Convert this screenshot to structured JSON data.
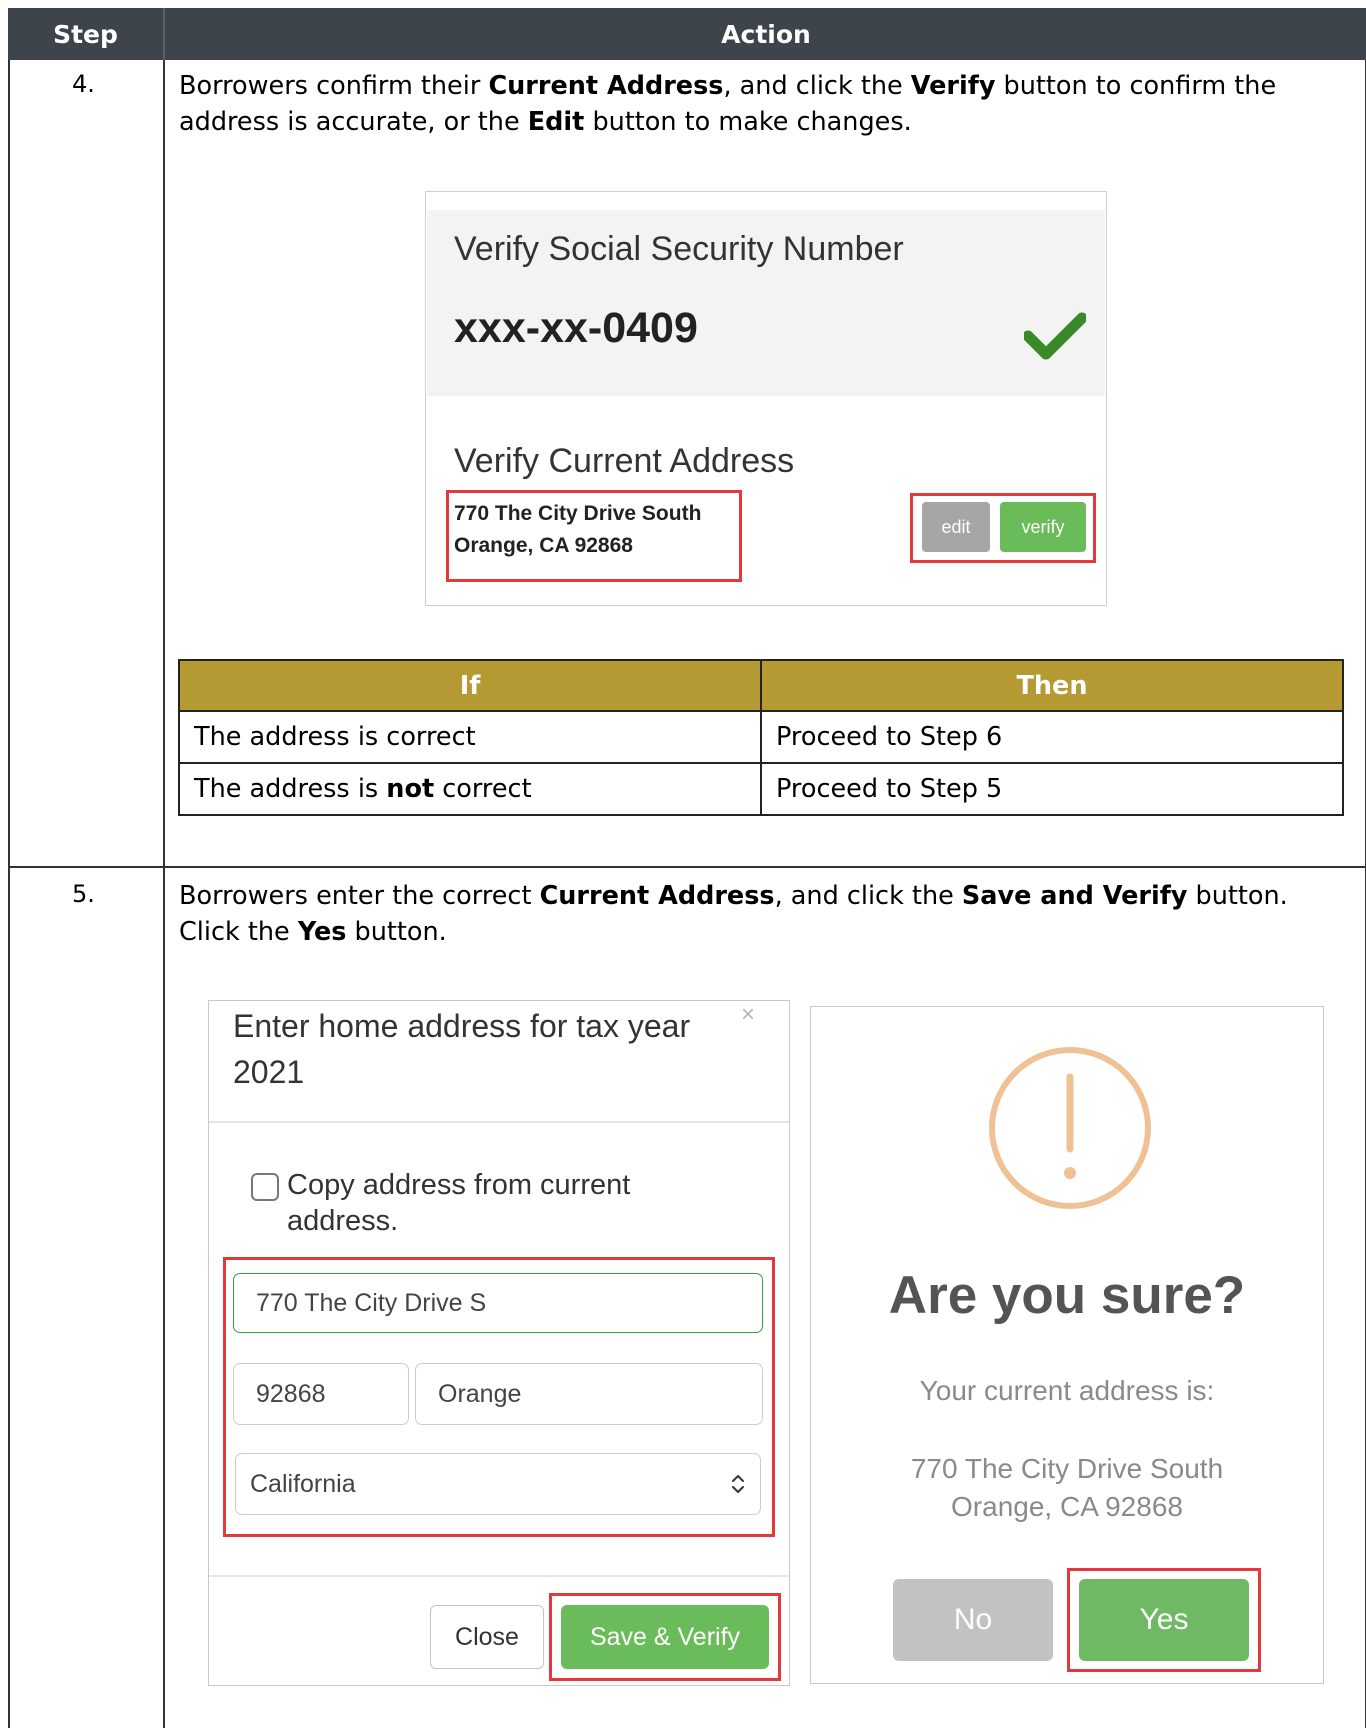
{
  "table": {
    "col_step": "Step",
    "col_action": "Action"
  },
  "step4": {
    "number": "4.",
    "text_1": "Borrowers confirm their ",
    "bold_1": "Current Address",
    "text_2": ", and click the ",
    "bold_2": "Verify",
    "text_3": " button to confirm the address is accurate, or the ",
    "bold_3": "Edit",
    "text_4": " button to make changes.",
    "screenshot": {
      "ssn_title": "Verify Social Security Number",
      "ssn_value": "xxx-xx-0409",
      "address_title": "Verify Current Address",
      "address_line1": "770 The City Drive South",
      "address_line2": "Orange, CA 92868",
      "edit_label": "edit",
      "verify_label": "verify"
    },
    "if_then": {
      "col_if": "If",
      "col_then": "Then",
      "row1_if": "The address is correct",
      "row1_then": "Proceed to Step 6",
      "row2_if_a": "The address is ",
      "row2_if_b": "not",
      "row2_if_c": " correct",
      "row2_then": "Proceed to Step 5"
    }
  },
  "step5": {
    "number": "5.",
    "text_1": "Borrowers enter the correct ",
    "bold_1": "Current Address",
    "text_2": ", and click the ",
    "bold_2": "Save and Verify",
    "text_3": " button. Click the ",
    "bold_3": "Yes",
    "text_4": " button.",
    "modal": {
      "title": "Enter home address for tax year 2021",
      "close_x": "×",
      "copy_label_1": "Copy address from current",
      "copy_label_2": "address.",
      "street_value": "770 The City Drive S",
      "zip_value": "92868",
      "city_value": "Orange",
      "state_value": "California",
      "close_label": "Close",
      "save_label": "Save & Verify"
    },
    "confirm": {
      "heading": "Are you sure?",
      "current_label": "Your current address is:",
      "address_line1": "770 The City Drive South",
      "address_line2": "Orange, CA 92868",
      "no_label": "No",
      "yes_label": "Yes"
    }
  },
  "colors": {
    "header_bg": "#3d444c",
    "if_then_header": "#b59a34",
    "highlight_red": "#e5383b",
    "green_button": "#6abc5a",
    "warning_orange": "#efc195"
  }
}
